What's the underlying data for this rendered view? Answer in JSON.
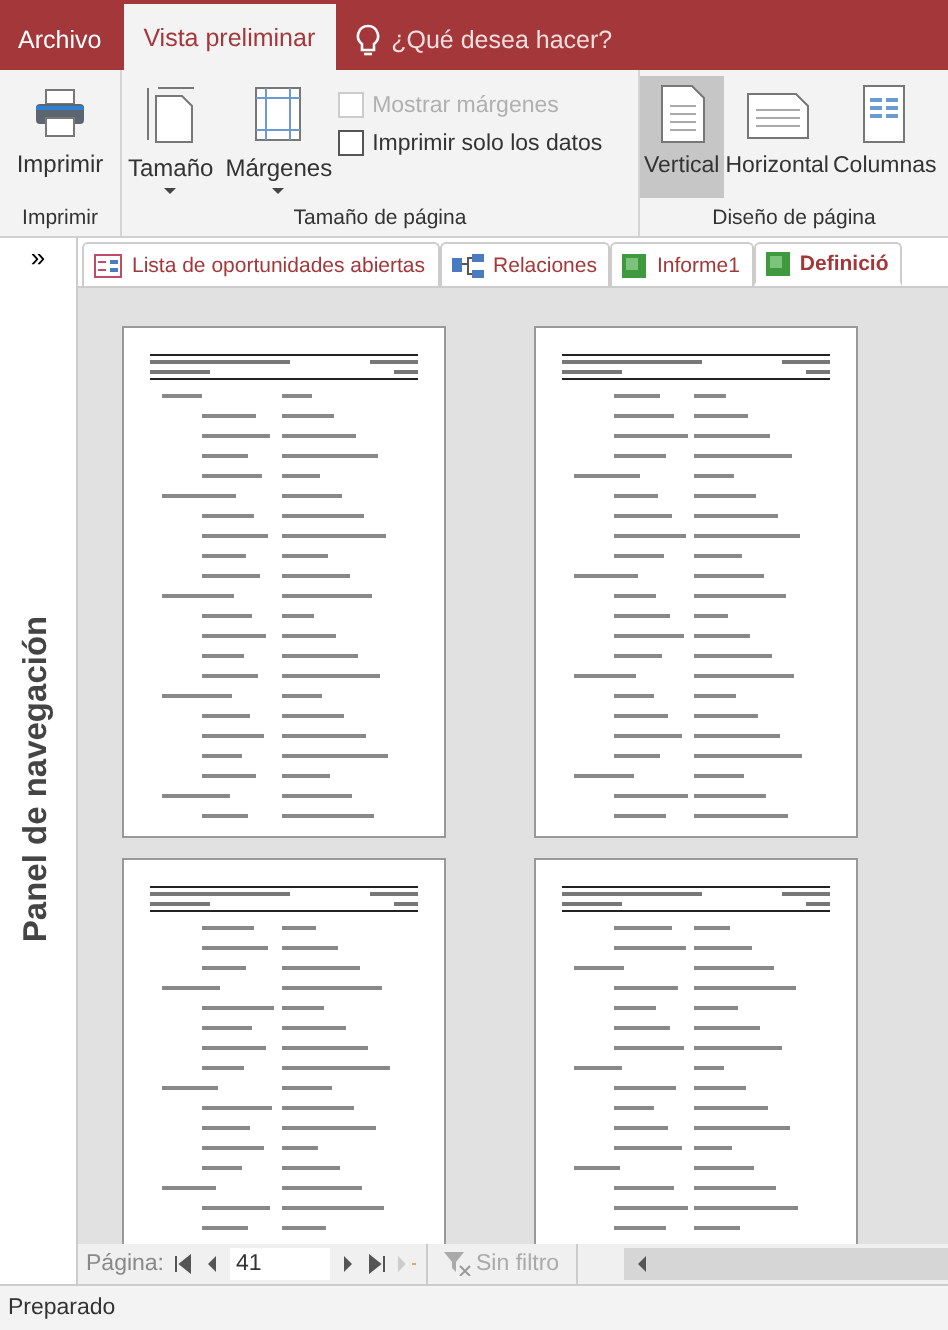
{
  "ribbon_tabs": [
    {
      "label": "Archivo",
      "selected": false
    },
    {
      "label": "Vista preliminar",
      "selected": true
    }
  ],
  "tell_me": {
    "placeholder": "¿Qué desea hacer?"
  },
  "ribbon": {
    "print_button": "Imprimir",
    "size_button": "Tamaño",
    "margins_button": "Márgenes",
    "checkboxes": [
      {
        "label": "Mostrar márgenes",
        "checked": false,
        "disabled": true
      },
      {
        "label": "Imprimir solo los datos",
        "checked": false,
        "disabled": false
      }
    ],
    "orientation_buttons": [
      {
        "label": "Vertical",
        "kind": "portrait",
        "selected": true
      },
      {
        "label": "Horizontal",
        "kind": "landscape",
        "selected": false
      },
      {
        "label": "Columnas",
        "kind": "columns",
        "selected": false
      }
    ],
    "groups": [
      "Imprimir",
      "Tamaño de página",
      "Diseño de página"
    ]
  },
  "nav_pane": {
    "toggle": "»",
    "title": "Panel de navegación"
  },
  "doc_tabs": [
    {
      "label": "Lista de oportunidades abiertas",
      "kind": "form",
      "selected": false
    },
    {
      "label": "Relaciones",
      "kind": "relations",
      "selected": false
    },
    {
      "label": "Informe1",
      "kind": "report",
      "selected": false
    },
    {
      "label": "Definició",
      "kind": "report",
      "selected": true
    }
  ],
  "preview_pages": [
    {
      "kind": "page"
    },
    {
      "kind": "page"
    },
    {
      "kind": "page"
    },
    {
      "kind": "page"
    }
  ],
  "record_nav": {
    "label": "Página:",
    "value": "41",
    "filter": "Sin filtro"
  },
  "status_bar": "Preparado"
}
